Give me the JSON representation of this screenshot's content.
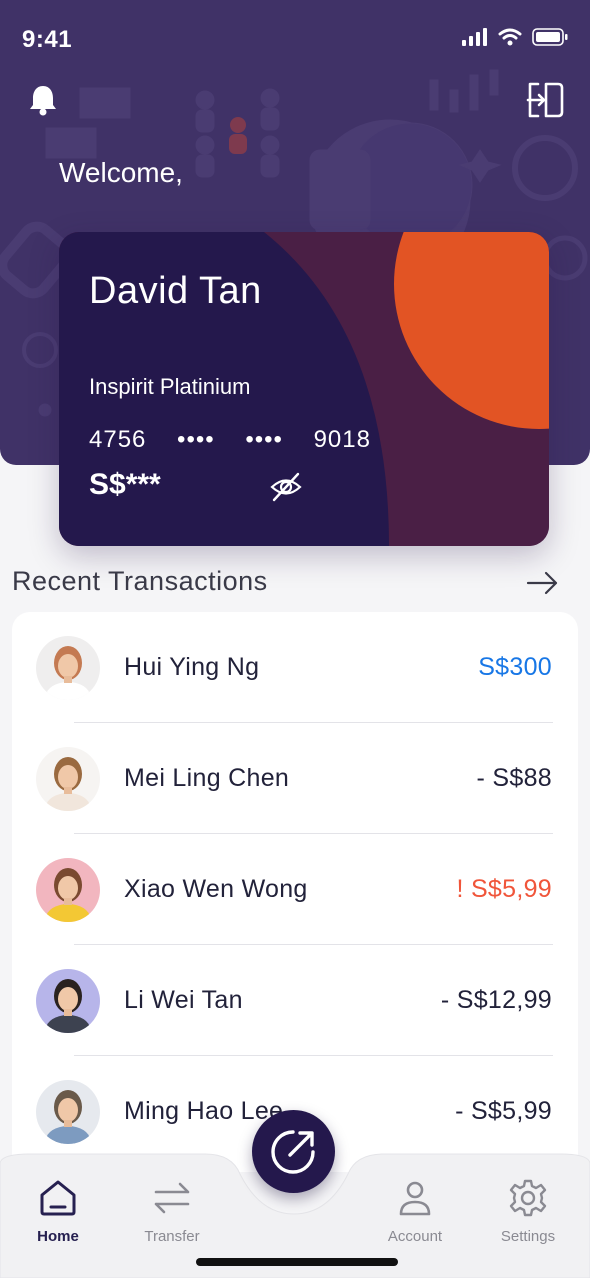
{
  "status": {
    "time": "9:41"
  },
  "header": {
    "welcome": "Welcome,"
  },
  "card": {
    "holder": "David Tan",
    "product": "Inspirit Platinium",
    "number_first": "4756",
    "number_mask_1": "••••",
    "number_mask_2": "••••",
    "number_last": "9018",
    "balance_masked": "S$***",
    "colors": {
      "base": "#24184c",
      "mid": "#4a1f45",
      "accent": "#e25424"
    }
  },
  "recent": {
    "title": "Recent Transactions",
    "items": [
      {
        "name": "Hui Ying Ng",
        "amount": "S$300",
        "amount_color": "#1877e6",
        "avatar_bg": "#efeeee",
        "hair": "#c47a52",
        "shirt": "#ffffff"
      },
      {
        "name": "Mei Ling Chen",
        "amount": "- S$88",
        "amount_color": "#22223a",
        "avatar_bg": "#f6f4f2",
        "hair": "#9a6a40",
        "shirt": "#f1e6dc"
      },
      {
        "name": "Xiao Wen Wong",
        "amount": "! S$5,99",
        "amount_color": "#f0553a",
        "avatar_bg": "#f2b6bf",
        "hair": "#7a4a30",
        "shirt": "#f3c834"
      },
      {
        "name": "Li Wei Tan",
        "amount": "- S$12,99",
        "amount_color": "#22223a",
        "avatar_bg": "#b7b5ea",
        "hair": "#2a2220",
        "shirt": "#3d4250"
      },
      {
        "name": "Ming Hao Lee",
        "amount": "- S$5,99",
        "amount_color": "#22223a",
        "avatar_bg": "#e6e9ee",
        "hair": "#6a5a4a",
        "shirt": "#7d9bc0"
      }
    ]
  },
  "tabs": {
    "home": "Home",
    "transfer": "Transfer",
    "account": "Account",
    "settings": "Settings"
  },
  "colors": {
    "hero": "#403267",
    "brand_dark": "#24184c"
  }
}
